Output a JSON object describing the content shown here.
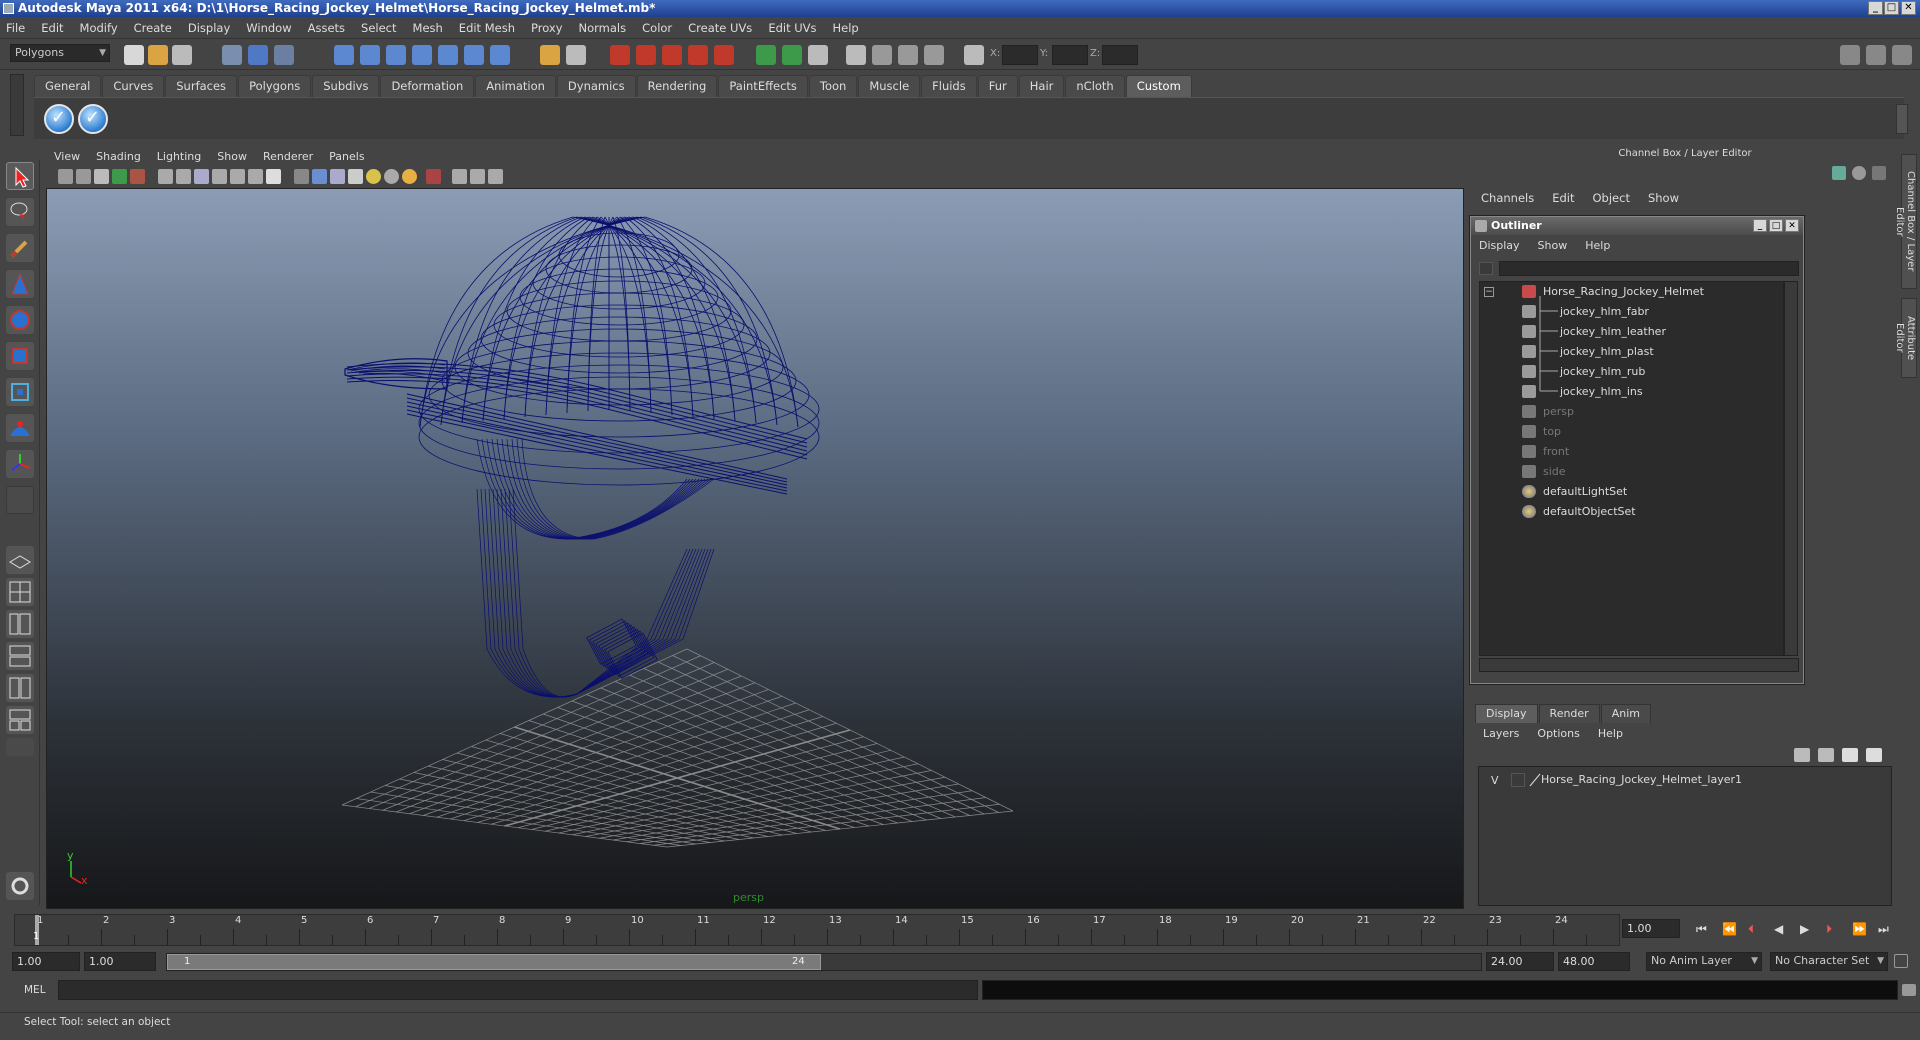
{
  "window": {
    "title": "Autodesk Maya 2011 x64: D:\\1\\Horse_Racing_Jockey_Helmet\\Horse_Racing_Jockey_Helmet.mb*"
  },
  "menubar": [
    "File",
    "Edit",
    "Modify",
    "Create",
    "Display",
    "Window",
    "Assets",
    "Select",
    "Mesh",
    "Edit Mesh",
    "Proxy",
    "Normals",
    "Color",
    "Create UVs",
    "Edit UVs",
    "Help"
  ],
  "statusline": {
    "menuset": "Polygons",
    "coord_x_label": "X:",
    "coord_y_label": "Y:",
    "coord_z_label": "Z:"
  },
  "shelf": {
    "tabs": [
      "General",
      "Curves",
      "Surfaces",
      "Polygons",
      "Subdivs",
      "Deformation",
      "Animation",
      "Dynamics",
      "Rendering",
      "PaintEffects",
      "Toon",
      "Muscle",
      "Fluids",
      "Fur",
      "Hair",
      "nCloth",
      "Custom"
    ],
    "active_tab": "Custom"
  },
  "viewport": {
    "menu": [
      "View",
      "Shading",
      "Lighting",
      "Show",
      "Renderer",
      "Panels"
    ],
    "camera_label": "persp",
    "axis_y": "y",
    "axis_x": "x",
    "wire_color": "#0a0f6e",
    "grid_color": "#8a8a8a"
  },
  "channelbox": {
    "header": "Channel Box / Layer Editor",
    "menu": [
      "Channels",
      "Edit",
      "Object",
      "Show"
    ]
  },
  "sidetabs": {
    "channel_box": "Channel Box / Layer Editor",
    "attribute_editor": "Attribute Editor"
  },
  "outliner": {
    "title": "Outliner",
    "menu": [
      "Display",
      "Show",
      "Help"
    ],
    "items": [
      {
        "label": "Horse_Racing_Jockey_Helmet",
        "dim": false
      },
      {
        "label": "jockey_hlm_fabr",
        "dim": false
      },
      {
        "label": "jockey_hlm_leather",
        "dim": false
      },
      {
        "label": "jockey_hlm_plast",
        "dim": false
      },
      {
        "label": "jockey_hlm_rub",
        "dim": false
      },
      {
        "label": "jockey_hlm_ins",
        "dim": false
      },
      {
        "label": "persp",
        "dim": true
      },
      {
        "label": "top",
        "dim": true
      },
      {
        "label": "front",
        "dim": true
      },
      {
        "label": "side",
        "dim": true
      },
      {
        "label": "defaultLightSet",
        "dim": false
      },
      {
        "label": "defaultObjectSet",
        "dim": false
      }
    ]
  },
  "layers": {
    "tabs": [
      "Display",
      "Render",
      "Anim"
    ],
    "active_tab": "Display",
    "menu": [
      "Layers",
      "Options",
      "Help"
    ],
    "layer_visibility": "V",
    "layer_name": "Horse_Racing_Jockey_Helmet_layer1"
  },
  "timeline": {
    "ticks": [
      "1",
      "2",
      "3",
      "4",
      "5",
      "6",
      "7",
      "8",
      "9",
      "10",
      "11",
      "12",
      "13",
      "14",
      "15",
      "16",
      "17",
      "18",
      "19",
      "20",
      "21",
      "22",
      "23",
      "24"
    ],
    "current_frame": "1",
    "current_time_field": "1.00"
  },
  "range": {
    "start_time": "1.00",
    "playback_start": "1.00",
    "slider_min": "1",
    "slider_max": "24",
    "playback_end": "24.00",
    "end_time": "48.00",
    "anim_layer": "No Anim Layer",
    "character_set": "No Character Set"
  },
  "command": {
    "mel_label": "MEL"
  },
  "helpline": {
    "text": "Select Tool: select an object"
  }
}
